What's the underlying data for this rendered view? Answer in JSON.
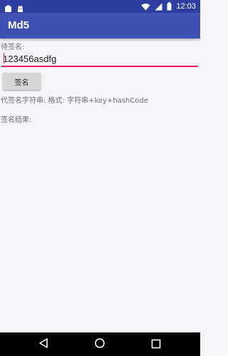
{
  "status_bar": {
    "time": "12:03",
    "icons": [
      "notification-icon",
      "android-icon",
      "wifi-icon",
      "signal-icon",
      "battery-icon"
    ]
  },
  "app_bar": {
    "title": "Md5",
    "color": "#3f51b5"
  },
  "form": {
    "input_label": "待签名:",
    "input_value": "123456asdfg",
    "sign_button_label": "签名",
    "pending_string_text": "代签名字符串:  格式: 字符串+key+hashCode",
    "result_label": "签名结果:",
    "accent_color": "#e91e63"
  },
  "nav_bar": {
    "icons": [
      "back-icon",
      "home-icon",
      "recents-icon"
    ]
  }
}
